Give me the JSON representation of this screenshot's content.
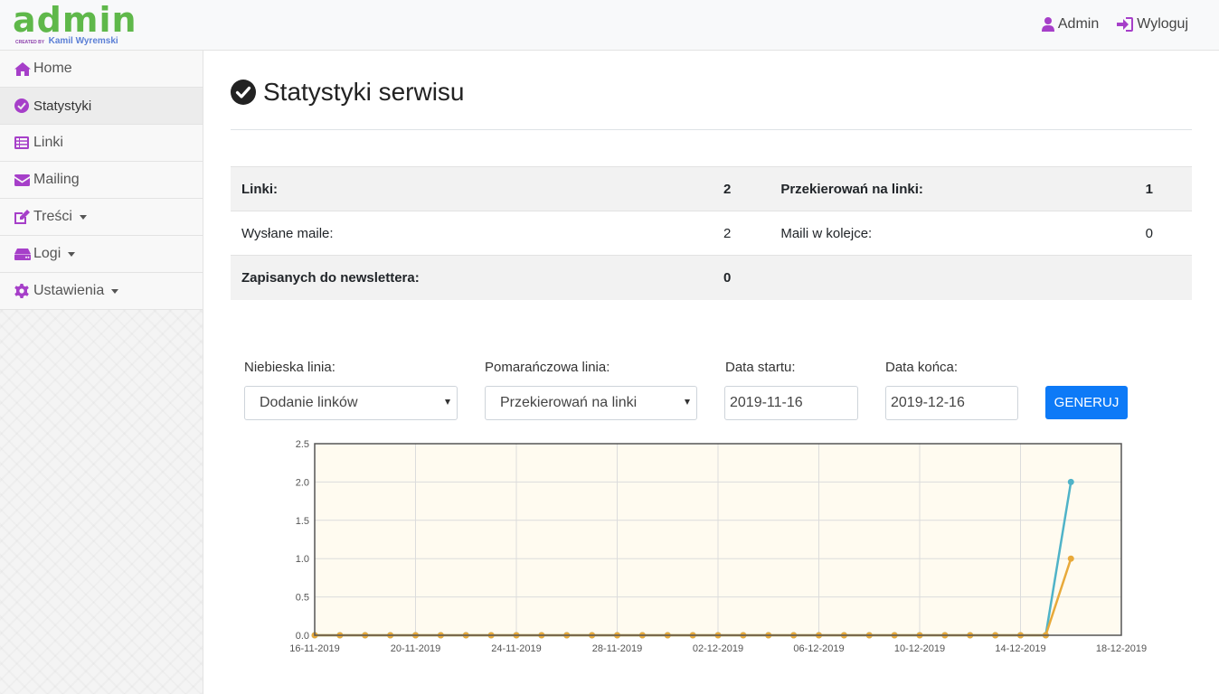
{
  "brand": {
    "logo": "admin",
    "created_by": "CREATED BY",
    "author": "Kamil Wyremski"
  },
  "topnav": {
    "user": "Admin",
    "logout": "Wyloguj"
  },
  "sidebar": {
    "items": [
      {
        "label": "Home",
        "icon": "home-icon"
      },
      {
        "label": "Statystyki",
        "icon": "check-circle-icon",
        "active": true
      },
      {
        "label": "Linki",
        "icon": "list-icon"
      },
      {
        "label": "Mailing",
        "icon": "envelope-icon"
      },
      {
        "label": "Treści",
        "icon": "edit-icon",
        "dropdown": true
      },
      {
        "label": "Logi",
        "icon": "hdd-icon",
        "dropdown": true
      },
      {
        "label": "Ustawienia",
        "icon": "gear-icon",
        "dropdown": true
      }
    ]
  },
  "page": {
    "title": "Statystyki serwisu"
  },
  "stats": {
    "rows": [
      {
        "l1": "Linki:",
        "v1": "2",
        "l2": "Przekierowań na linki:",
        "v2": "1"
      },
      {
        "l1": "Wysłane maile:",
        "v1": "2",
        "l2": "Maili w kolejce:",
        "v2": "0"
      },
      {
        "l1": "Zapisanych do newslettera:",
        "v1": "0",
        "l2": "",
        "v2": ""
      }
    ]
  },
  "form": {
    "blue_label": "Niebieska linia:",
    "blue_value": "Dodanie linków",
    "orange_label": "Pomarańczowa linia:",
    "orange_value": "Przekierowań na linki",
    "start_label": "Data startu:",
    "start_value": "2019-11-16",
    "end_label": "Data końca:",
    "end_value": "2019-12-16",
    "submit": "GENERUJ"
  },
  "colors": {
    "accent": "#a63fc9",
    "brand_green": "#5fb84a",
    "button": "#0d7af7",
    "blue_line": "#4fb3c8",
    "orange_line": "#e8a93a",
    "plot_bg": "#fffbf0"
  },
  "chart_data": {
    "type": "line",
    "x": [
      "2019-11-16",
      "2019-11-17",
      "2019-11-18",
      "2019-11-19",
      "2019-11-20",
      "2019-11-21",
      "2019-11-22",
      "2019-11-23",
      "2019-11-24",
      "2019-11-25",
      "2019-11-26",
      "2019-11-27",
      "2019-11-28",
      "2019-11-29",
      "2019-11-30",
      "2019-12-01",
      "2019-12-02",
      "2019-12-03",
      "2019-12-04",
      "2019-12-05",
      "2019-12-06",
      "2019-12-07",
      "2019-12-08",
      "2019-12-09",
      "2019-12-10",
      "2019-12-11",
      "2019-12-12",
      "2019-12-13",
      "2019-12-14",
      "2019-12-15",
      "2019-12-16"
    ],
    "series": [
      {
        "color": "#4fb3c8",
        "values": [
          0,
          0,
          0,
          0,
          0,
          0,
          0,
          0,
          0,
          0,
          0,
          0,
          0,
          0,
          0,
          0,
          0,
          0,
          0,
          0,
          0,
          0,
          0,
          0,
          0,
          0,
          0,
          0,
          0,
          0,
          2
        ]
      },
      {
        "color": "#e8a93a",
        "values": [
          0,
          0,
          0,
          0,
          0,
          0,
          0,
          0,
          0,
          0,
          0,
          0,
          0,
          0,
          0,
          0,
          0,
          0,
          0,
          0,
          0,
          0,
          0,
          0,
          0,
          0,
          0,
          0,
          0,
          0,
          1
        ]
      }
    ],
    "ylim": [
      0,
      2.5
    ],
    "yticks": [
      "0.0",
      "0.5",
      "1.0",
      "1.5",
      "2.0",
      "2.5"
    ],
    "xticks": [
      "16-11-2019",
      "20-11-2019",
      "24-11-2019",
      "28-11-2019",
      "02-12-2019",
      "06-12-2019",
      "10-12-2019",
      "14-12-2019",
      "18-12-2019"
    ],
    "xlim": [
      "2019-11-16",
      "2019-12-18"
    ],
    "grid": true
  }
}
